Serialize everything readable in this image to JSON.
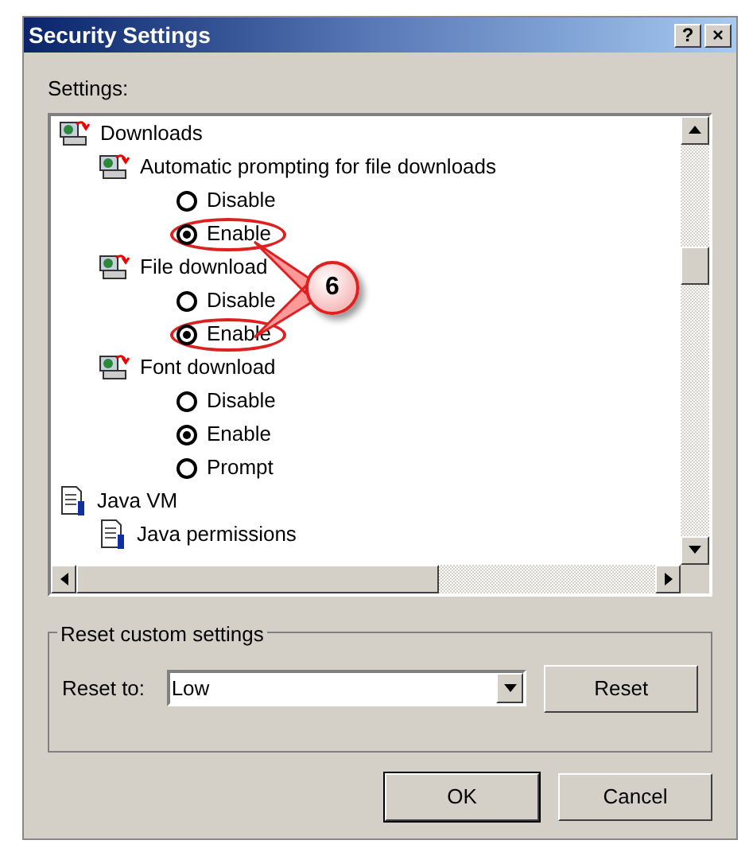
{
  "window": {
    "title": "Security Settings",
    "buttons": [
      "?",
      "×"
    ]
  },
  "settings_label": "Settings:",
  "tree": [
    {
      "kind": "group",
      "label": "Downloads",
      "children": [
        {
          "kind": "group",
          "label": "Automatic prompting for file downloads",
          "children": [
            {
              "kind": "radio",
              "label": "Disable",
              "selected": false,
              "circled": false
            },
            {
              "kind": "radio",
              "label": "Enable",
              "selected": true,
              "circled": true
            }
          ]
        },
        {
          "kind": "group",
          "label": "File download",
          "children": [
            {
              "kind": "radio",
              "label": "Disable",
              "selected": false,
              "circled": false
            },
            {
              "kind": "radio",
              "label": "Enable",
              "selected": true,
              "circled": true
            }
          ]
        },
        {
          "kind": "group",
          "label": "Font download",
          "children": [
            {
              "kind": "radio",
              "label": "Disable",
              "selected": false,
              "circled": false
            },
            {
              "kind": "radio",
              "label": "Enable",
              "selected": true,
              "circled": false
            },
            {
              "kind": "radio",
              "label": "Prompt",
              "selected": false,
              "circled": false
            }
          ]
        }
      ]
    },
    {
      "kind": "group",
      "label": "Java VM",
      "children": [
        {
          "kind": "group",
          "label": "Java permissions"
        }
      ]
    }
  ],
  "callout": {
    "label": "6"
  },
  "reset_group": {
    "title": "Reset custom settings",
    "label": "Reset to:",
    "value": "Low",
    "button": "Reset"
  },
  "buttons": [
    "OK",
    "Cancel"
  ]
}
